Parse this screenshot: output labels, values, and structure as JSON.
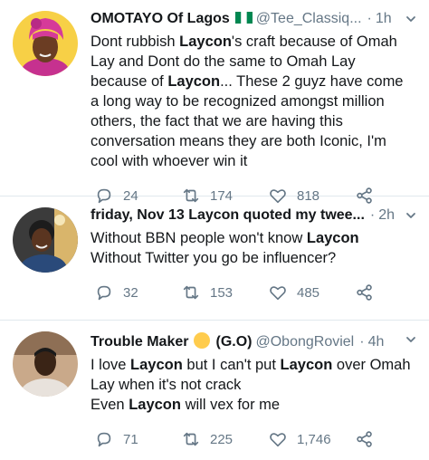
{
  "tweets": [
    {
      "name": "OMOTAYO Of Lagos",
      "handle": "@Tee_Classiq...",
      "separator": "·",
      "time": "1h",
      "body_segments": [
        {
          "text": "Dont rubbish ",
          "bold": false
        },
        {
          "text": "Laycon",
          "bold": true
        },
        {
          "text": "'s craft because of Omah Lay and Dont do the same to Omah Lay because of ",
          "bold": false
        },
        {
          "text": "Laycon",
          "bold": true
        },
        {
          "text": "... These 2 guyz have come a long way to be recognized amongst million others, the fact that we are having this conversation means they are both Iconic, I'm cool with whoever win it",
          "bold": false
        }
      ],
      "replies": "24",
      "retweets": "174",
      "likes": "818"
    },
    {
      "name": "friday, Nov 13 Laycon quoted my twee...",
      "handle": "",
      "separator": "·",
      "time": "2h",
      "body_segments": [
        {
          "text": "Without BBN people won't know ",
          "bold": false
        },
        {
          "text": "Laycon",
          "bold": true
        },
        {
          "text": "\nWithout Twitter you go be influencer?",
          "bold": false
        }
      ],
      "replies": "32",
      "retweets": "153",
      "likes": "485"
    },
    {
      "name": "Trouble Maker",
      "name_suffix": "(G.O)",
      "handle": "@ObongRoviel",
      "separator": "·",
      "time": "4h",
      "body_segments": [
        {
          "text": "I love ",
          "bold": false
        },
        {
          "text": "Laycon",
          "bold": true
        },
        {
          "text": " but I can't put ",
          "bold": false
        },
        {
          "text": "Laycon",
          "bold": true
        },
        {
          "text": " over Omah Lay when it's not crack\nEven ",
          "bold": false
        },
        {
          "text": "Laycon",
          "bold": true
        },
        {
          "text": " will vex for me",
          "bold": false
        }
      ],
      "replies": "71",
      "retweets": "225",
      "likes": "1,746"
    }
  ],
  "icons": {
    "reply": "reply-icon",
    "retweet": "retweet-icon",
    "like": "heart-icon",
    "share": "share-icon",
    "menu": "chevron-down-icon",
    "flag": "nigeria-flag-icon",
    "emoji": "unamused-face-emoji"
  },
  "colors": {
    "text": "#14171a",
    "secondary": "#657786",
    "divider": "#e1e8ed",
    "avatar1_bg": "#f7d046",
    "avatar1_wrap": "#c6318f"
  }
}
